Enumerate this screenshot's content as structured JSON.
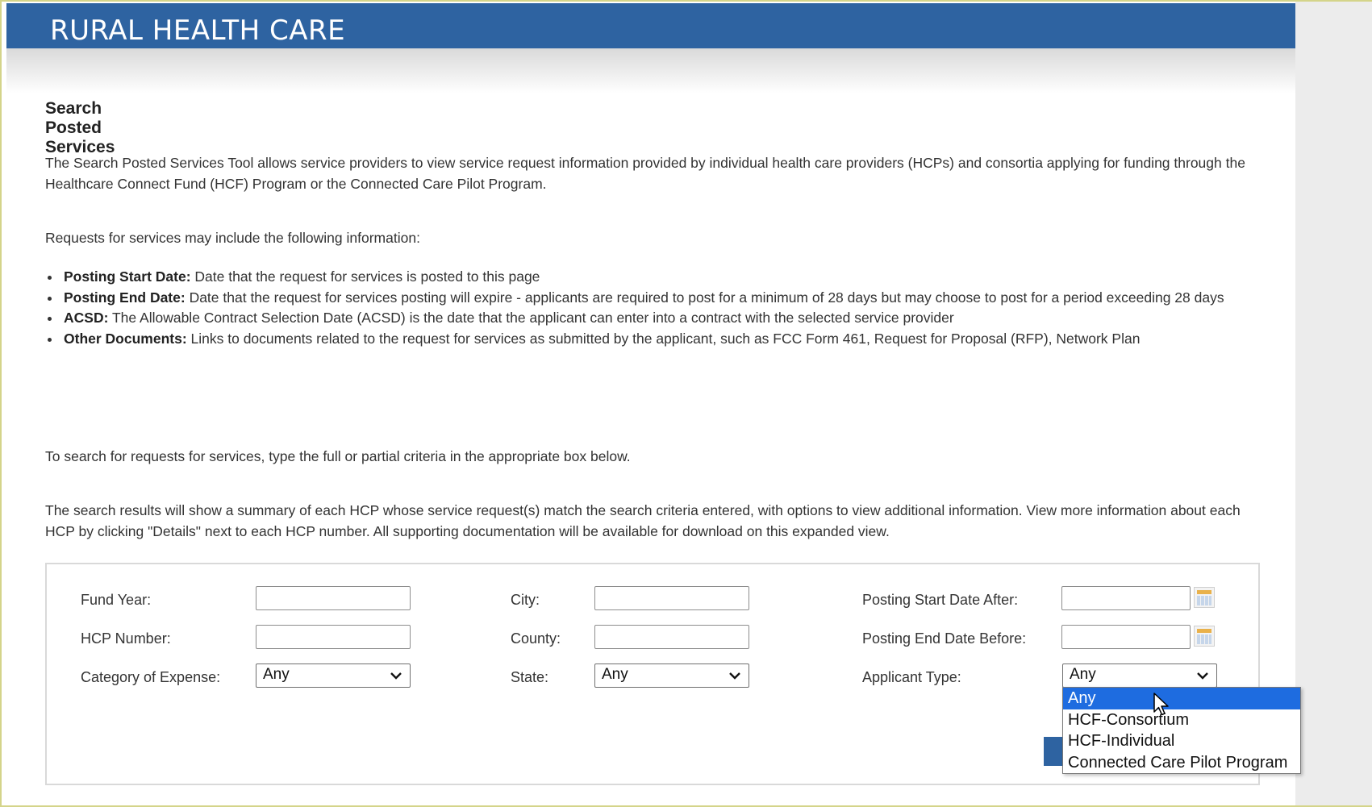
{
  "header": {
    "title": "RURAL HEALTH CARE"
  },
  "page": {
    "title": "Search Posted Services",
    "intro": "The Search Posted Services Tool allows service providers to view service request information provided by individual health care providers (HCPs) and consortia applying for funding through the Healthcare Connect Fund (HCF) Program or the Connected Care Pilot Program.",
    "requests_intro": "Requests for services may include the following information:",
    "bullets": [
      {
        "term": "Posting Start Date:",
        "text": " Date that the request for services is posted to this page"
      },
      {
        "term": "Posting End Date:",
        "text": " Date that the request for services posting will expire - applicants are required to post for a minimum of 28 days but may choose to post for a period exceeding 28 days"
      },
      {
        "term": "ACSD:",
        "text": " The Allowable Contract Selection Date (ACSD) is the date that the applicant can enter into a contract with the selected service provider"
      },
      {
        "term": "Other Documents:",
        "text": " Links to documents related to the request for services as submitted by the applicant, such as FCC Form 461, Request for Proposal (RFP), Network Plan"
      }
    ],
    "search_instructions": "To search for requests for services, type the full or partial criteria in the appropriate box below.",
    "results_instructions": "The search results will show a summary of each HCP whose service request(s) match the search criteria entered, with options to view additional information. View more information about each HCP by clicking \"Details\" next to each HCP number. All supporting documentation will be available for download on this expanded view."
  },
  "form": {
    "fund_year": {
      "label": "Fund Year:",
      "value": ""
    },
    "hcp_number": {
      "label": "HCP Number:",
      "value": ""
    },
    "category": {
      "label": "Category of Expense:",
      "value": "Any"
    },
    "city": {
      "label": "City:",
      "value": ""
    },
    "county": {
      "label": "County:",
      "value": ""
    },
    "state": {
      "label": "State:",
      "value": "Any"
    },
    "posting_start": {
      "label": "Posting Start Date After:",
      "value": ""
    },
    "posting_end": {
      "label": "Posting End Date Before:",
      "value": ""
    },
    "applicant_type": {
      "label": "Applicant Type:",
      "value": "Any",
      "options": [
        "Any",
        "HCF-Consortium",
        "HCF-Individual",
        "Connected Care Pilot Program"
      ],
      "selected_index": 0
    }
  },
  "icons": {
    "calendar": "calendar-icon",
    "chevron": "chevron-down-icon",
    "cursor": "mouse-pointer-icon"
  },
  "colors": {
    "header": "#2e63a1",
    "selection": "#1e6ce0"
  }
}
